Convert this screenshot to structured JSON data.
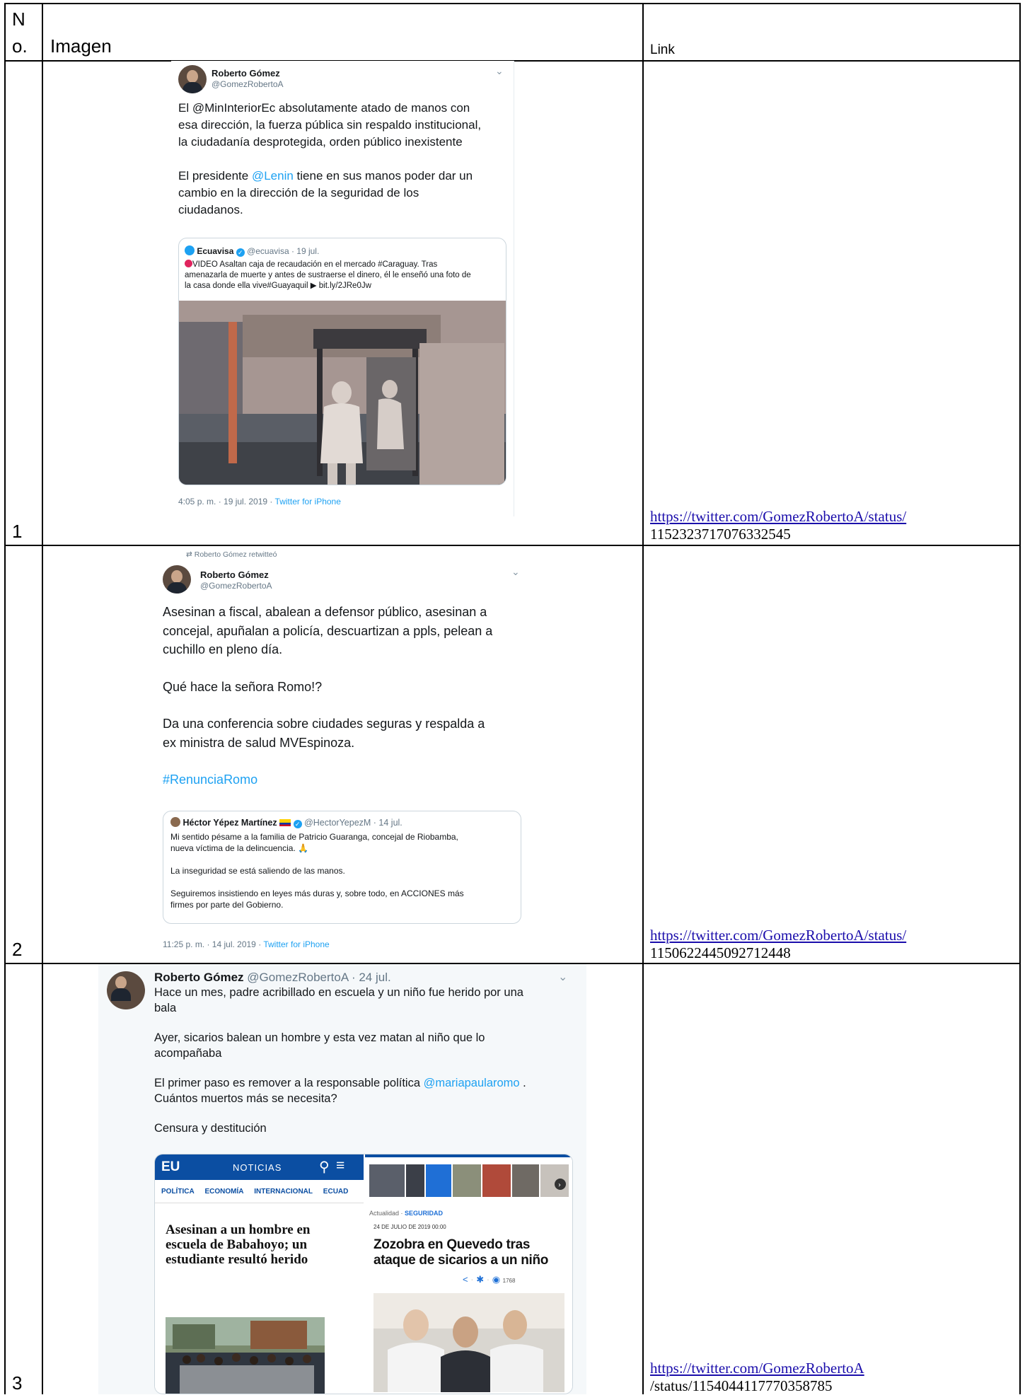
{
  "table": {
    "header": {
      "no_line1": "N",
      "no_line2": "o.",
      "imagen": "Imagen",
      "link": "Link"
    },
    "rows": [
      {
        "number": "1",
        "link_line1": "https://twitter.com/GomezRobertoA/status/",
        "link_line2": "1152323717076332545",
        "tweet": {
          "name": "Roberto Gómez",
          "handle": "@GomezRobertoA",
          "body_p1_a": "El @MinInteriorEc absolutamente atado de manos con",
          "body_p1_b": "esa dirección, la fuerza pública sin respaldo institucional,",
          "body_p1_c": "la ciudadanía desprotegida, orden público inexistente",
          "body_p2_a_pre": "El presidente ",
          "body_p2_a_mention": "@Lenin",
          "body_p2_a_post": " tiene en sus manos poder dar un",
          "body_p2_b": "cambio en la dirección de la seguridad de los",
          "body_p2_c": "ciudadanos.",
          "quote_name": "Ecuavisa",
          "quote_handle_date": "@ecuavisa · 19 jul.",
          "quote_line1": "VIDEO Asaltan caja de recaudación en el mercado #Caraguay. Tras",
          "quote_line2": "amenazarla de muerte y antes de sustraerse el dinero, él le enseñó una foto de",
          "quote_line3": "la casa donde ella vive#Guayaquil ▶ bit.ly/2JRe0Jw",
          "time": "4:05 p. m. · 19 jul. 2019 · ",
          "source": "Twitter for iPhone"
        }
      },
      {
        "number": "2",
        "link_line1": "https://twitter.com/GomezRobertoA/status/",
        "link_line2": "1150622445092712448",
        "tweet": {
          "retweeted": "Roberto Gómez retwitteó",
          "name": "Roberto Gómez",
          "handle": "@GomezRobertoA",
          "body_l1": "Asesinan a fiscal, abalean a defensor público, asesinan a",
          "body_l2": "concejal, apuñalan a policía, descuartizan a ppls, pelean a",
          "body_l3": "cuchillo en pleno día.",
          "body_l4": "Qué hace la señora Romo!?",
          "body_l5": "Da una conferencia sobre ciudades seguras y respalda a",
          "body_l6": "ex ministra de salud MVEspinoza.",
          "hashtag": "#RenunciaRomo",
          "quote_name": "Héctor Yépez Martínez",
          "quote_handle_date": "@HectorYepezM · 14 jul.",
          "quote_line1": "Mi sentido pésame a la familia de Patricio Guaranga, concejal de Riobamba,",
          "quote_line2": "nueva víctima de la delincuencia. 🙏",
          "quote_line3": "La inseguridad se está saliendo de las manos.",
          "quote_line4": "Seguiremos insistiendo en leyes más duras y, sobre todo, en ACCIONES más",
          "quote_line5": "firmes por parte del Gobierno.",
          "time": "11:25 p. m. · 14 jul. 2019 · ",
          "source": "Twitter for iPhone"
        }
      },
      {
        "number": "3",
        "link_line1": "https://twitter.com/GomezRobertoA",
        "link_line2": "/status/1154044117770358785",
        "tweet": {
          "name": "Roberto Gómez",
          "handle_date": "@GomezRobertoA · 24 jul.",
          "body_l1": "Hace un mes, padre acribillado en escuela y un niño fue herido por una",
          "body_l2": "bala",
          "body_l3": "Ayer, sicarios balean un hombre y esta vez matan al niño que lo",
          "body_l4": "acompañaba",
          "body_l5_pre": "El primer paso es remover a la responsable política ",
          "body_l5_mention": "@mariapaularomo",
          "body_l5_post": " .",
          "body_l6": "Cuántos muertos más se necesita?",
          "body_l7": "Censura y destitución",
          "left_img": {
            "logo": "EU",
            "section": "NOTICIAS",
            "nav": [
              "POLÍTICA",
              "ECONOMÍA",
              "INTERNACIONAL",
              "ECUAD"
            ],
            "headline_l1": "Asesinan a un hombre en",
            "headline_l2": "escuela de Babahoyo; un",
            "headline_l3": "estudiante resultó herido"
          },
          "right_img": {
            "category_pre": "Actualidad · ",
            "category": "SEGURIDAD",
            "date": "24 DE JULIO DE 2019 00:00",
            "headline_l1": "Zozobra en Quevedo tras",
            "headline_l2": "ataque de sicarios a un niño",
            "views": "1768"
          }
        }
      }
    ]
  }
}
